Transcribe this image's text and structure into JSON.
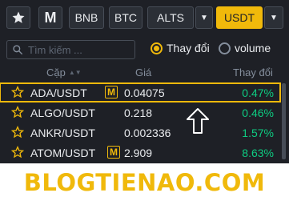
{
  "tabs": {
    "star_icon": "star-icon",
    "m_label": "M",
    "items": [
      "BNB",
      "BTC",
      "ALTS",
      "USDT"
    ],
    "active": "USDT"
  },
  "search": {
    "placeholder": "Tìm kiếm ..."
  },
  "radio": {
    "change_label": "Thay đổi",
    "volume_label": "volume",
    "selected": "Thay đổi"
  },
  "headers": {
    "pair": "Cặp",
    "price": "Giá",
    "change": "Thay đổi"
  },
  "rows": [
    {
      "pair": "ADA/USDT",
      "margin": "M",
      "price": "0.04075",
      "change": "0.47%",
      "highlighted": true
    },
    {
      "pair": "ALGO/USDT",
      "margin": "",
      "price": "0.218",
      "change": "0.46%",
      "highlighted": false
    },
    {
      "pair": "ANKR/USDT",
      "margin": "",
      "price": "0.002336",
      "change": "1.57%",
      "highlighted": false
    },
    {
      "pair": "ATOM/USDT",
      "margin": "M",
      "price": "2.909",
      "change": "8.63%",
      "highlighted": false
    }
  ],
  "colors": {
    "accent": "#f0b90b",
    "positive": "#0ecb81",
    "background": "#1e2026"
  },
  "watermark": "BLOGTIENAO.COM"
}
